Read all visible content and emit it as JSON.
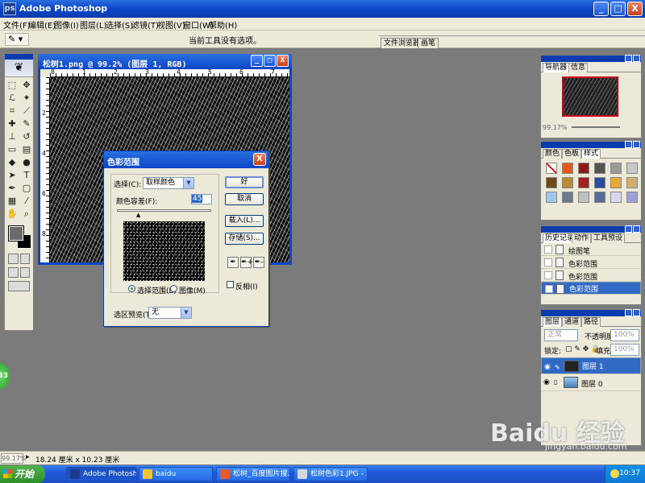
{
  "app": {
    "title": "Adobe Photoshop",
    "logo_glyph": "ps",
    "window_buttons": [
      "_",
      "□",
      "X"
    ]
  },
  "menu": [
    "文件(F)",
    "编辑(E)",
    "图像(I)",
    "图层(L)",
    "选择(S)",
    "滤镜(T)",
    "视图(V)",
    "窗口(W)",
    "帮助(H)"
  ],
  "options_bar": {
    "tool_glyph": "✎ ▾",
    "hint": "当前工具没有选项。",
    "tabs": [
      "文件浏览器",
      "画笔"
    ]
  },
  "document": {
    "title": "松树1.png @ 99.2% (图层 1, RGB)",
    "ruler_top": [
      "0",
      "1",
      "2",
      "3",
      "4",
      "5",
      "6",
      "7",
      "8",
      "9",
      "10",
      "11",
      "12",
      "13",
      "14",
      "15",
      "16",
      "17",
      "18"
    ],
    "ruler_left": [
      "2",
      "4",
      "6",
      "8"
    ],
    "buttons": [
      "_",
      "□",
      "X"
    ]
  },
  "dialog": {
    "title": "色彩范围",
    "close_glyph": "X",
    "select_label": "选择(C):",
    "select_value": "取样颜色",
    "fuzziness_label": "颜色容差(F):",
    "fuzziness_value": "45",
    "slider_fraction": 0.23,
    "radio_selection": "选择范围(E)",
    "radio_image": "图像(M)",
    "preview_label": "选区预览(T):",
    "preview_value": "无",
    "ok": "好",
    "cancel": "取消",
    "load": "载入(L)...",
    "save": "存储(S)...",
    "invert": "反相(I)",
    "eyedroppers": [
      "✒",
      "✒+",
      "✒-"
    ]
  },
  "navigator": {
    "tabs": [
      "导航器",
      "信息"
    ],
    "zoom": "99.17%"
  },
  "styles_panel": {
    "tabs": [
      "颜色",
      "色板",
      "样式"
    ],
    "swatches": [
      "#f8f8f8",
      "#e05a1c",
      "#8a1c1c",
      "#555555",
      "#9a9a9a",
      "#c8c8c8",
      "#6b4a1c",
      "#b88a3a",
      "#a02020",
      "#2a4c9a",
      "#e8a838",
      "#d0b070",
      "#9ec8e8",
      "#6a7a8a",
      "#c0c0c0",
      "#5a6a9a",
      "#d8d8f0",
      "#9aa0d8"
    ]
  },
  "history_panel": {
    "tabs": [
      "历史记录",
      "动作",
      "工具预设"
    ],
    "items": [
      "绘图笔",
      "色彩范围",
      "色彩范围",
      "色彩范围"
    ],
    "selected_index": 3
  },
  "layers_panel": {
    "tabs": [
      "图层",
      "通道",
      "路径"
    ],
    "blend_mode": "正常",
    "opacity_label": "不透明度:",
    "opacity_value": "100%",
    "lock_label": "锁定:",
    "fill_label": "填充:",
    "fill_value": "100%",
    "layers": [
      "图层 1",
      "图层 0"
    ],
    "selected_index": 0
  },
  "status": {
    "zoom": "99.17%",
    "dimensions": "18.24 厘米 x 10.23 厘米"
  },
  "taskbar": {
    "start": "开始",
    "items": [
      "Adobe Photoshop",
      "baidu",
      "松树_百度图片搜...",
      "松树色彩1.JPG - ..."
    ],
    "active_index": 0,
    "clock": "10:37"
  },
  "badge": "33",
  "watermark": {
    "text": "Baidu 经验",
    "url": "jingyan.baidu.com"
  }
}
